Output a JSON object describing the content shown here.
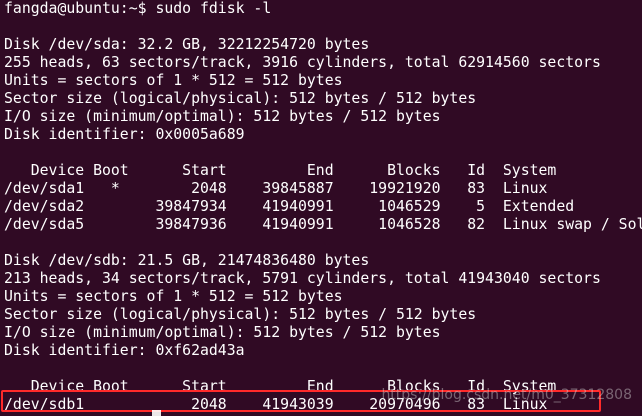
{
  "terminal": {
    "lines": [
      "fangda@ubuntu:~$ sudo fdisk -l",
      "",
      "Disk /dev/sda: 32.2 GB, 32212254720 bytes",
      "255 heads, 63 sectors/track, 3916 cylinders, total 62914560 sectors",
      "Units = sectors of 1 * 512 = 512 bytes",
      "Sector size (logical/physical): 512 bytes / 512 bytes",
      "I/O size (minimum/optimal): 512 bytes / 512 bytes",
      "Disk identifier: 0x0005a689",
      "",
      "   Device Boot      Start         End      Blocks   Id  System",
      "/dev/sda1   *        2048    39845887    19921920   83  Linux",
      "/dev/sda2        39847934    41940991     1046529    5  Extended",
      "/dev/sda5        39847936    41940991     1046528   82  Linux swap / Solaris",
      "",
      "Disk /dev/sdb: 21.5 GB, 21474836480 bytes",
      "213 heads, 34 sectors/track, 5791 cylinders, total 41943040 sectors",
      "Units = sectors of 1 * 512 = 512 bytes",
      "Sector size (logical/physical): 512 bytes / 512 bytes",
      "I/O size (minimum/optimal): 512 bytes / 512 bytes",
      "Disk identifier: 0xf62ad43a",
      "",
      "   Device Boot      Start         End      Blocks   Id  System",
      "/dev/sdb1            2048    41943039    20970496   83  Linux"
    ]
  },
  "watermark": "https://blog.csdn.net/m0_37312808",
  "colors": {
    "background": "#300a24",
    "text": "#ffffff",
    "highlight": "#ff2a2a"
  }
}
